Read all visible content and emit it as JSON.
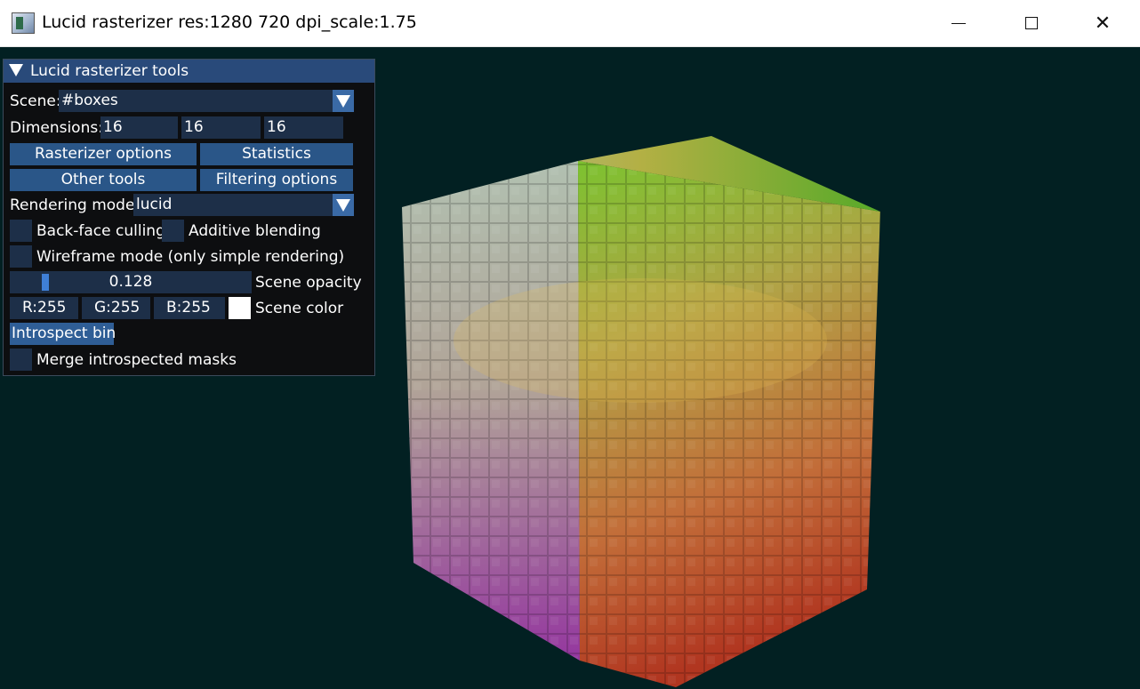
{
  "window": {
    "title": "Lucid rasterizer res:1280 720 dpi_scale:1.75",
    "minimize": "minimize",
    "maximize": "maximize",
    "close": "✕"
  },
  "panel": {
    "title": "Lucid rasterizer tools",
    "scene_label": "Scene:",
    "scene_value": "#boxes",
    "dimensions_label": "Dimensions:",
    "dimensions": [
      "16",
      "16",
      "16"
    ],
    "buttons": {
      "rasterizer_options": "Rasterizer options",
      "statistics": "Statistics",
      "other_tools": "Other tools",
      "filtering_options": "Filtering options",
      "introspect_bin": "Introspect bin"
    },
    "rendering_mode_label": "Rendering mode",
    "rendering_mode_value": "lucid",
    "checkboxes": {
      "back_face_culling": "Back-face culling",
      "additive_blending": "Additive blending",
      "wireframe_mode": "Wireframe mode (only simple rendering)",
      "merge_introspected_masks": "Merge introspected masks"
    },
    "scene_opacity": {
      "label": "Scene opacity",
      "value": "0.128",
      "fraction": 0.128
    },
    "scene_color": {
      "label": "Scene color",
      "r": "R:255",
      "g": "G:255",
      "b": "B:255",
      "swatch": "#ffffff"
    }
  },
  "colors": {
    "viewport_bg": "#022022",
    "panel_header": "#294a7a",
    "button": "#2a5688",
    "field": "#1d2f48",
    "slider_grab": "#3f7fd6"
  }
}
